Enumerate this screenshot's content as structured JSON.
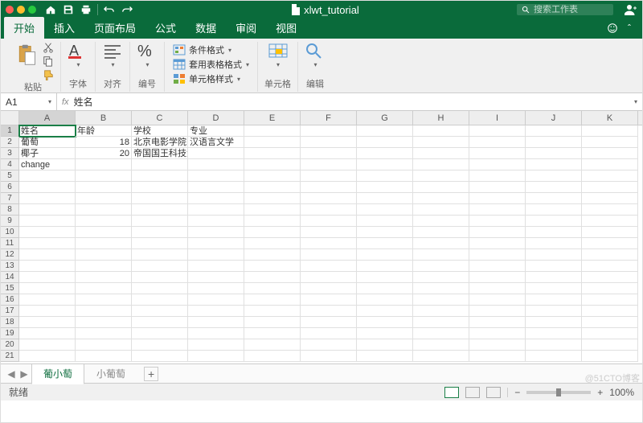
{
  "title": "xlwt_tutorial",
  "search_placeholder": "搜索工作表",
  "tabs": [
    "开始",
    "插入",
    "页面布局",
    "公式",
    "数据",
    "审阅",
    "视图"
  ],
  "active_tab": 0,
  "ribbon": {
    "paste": "粘贴",
    "font": "字体",
    "align": "对齐",
    "number": "编号",
    "cond_fmt": "条件格式",
    "table_fmt": "套用表格格式",
    "cell_style": "单元格样式",
    "cells": "单元格",
    "edit": "编辑"
  },
  "name_box": "A1",
  "fx": "fx",
  "formula_value": "姓名",
  "columns": [
    "A",
    "B",
    "C",
    "D",
    "E",
    "F",
    "G",
    "H",
    "I",
    "J",
    "K"
  ],
  "rows": 21,
  "active_cell": {
    "r": 0,
    "c": 0
  },
  "data": [
    [
      "姓名",
      "年龄",
      "学校",
      "专业",
      "",
      "",
      "",
      "",
      "",
      "",
      ""
    ],
    [
      "葡萄",
      "18",
      "北京电影学院",
      "汉语言文学",
      "",
      "",
      "",
      "",
      "",
      "",
      ""
    ],
    [
      "椰子",
      "20",
      "帝国国王科技大学",
      "",
      "",
      "",
      "",
      "",
      "",
      "",
      ""
    ],
    [
      "change",
      "",
      "",
      "",
      "",
      "",
      "",
      "",
      "",
      "",
      ""
    ]
  ],
  "numeric_cols": [
    1
  ],
  "sheets": [
    "葡小萄",
    "小葡萄"
  ],
  "active_sheet": 0,
  "status": "就绪",
  "zoom": "100%",
  "watermark": "@51CTO博客"
}
